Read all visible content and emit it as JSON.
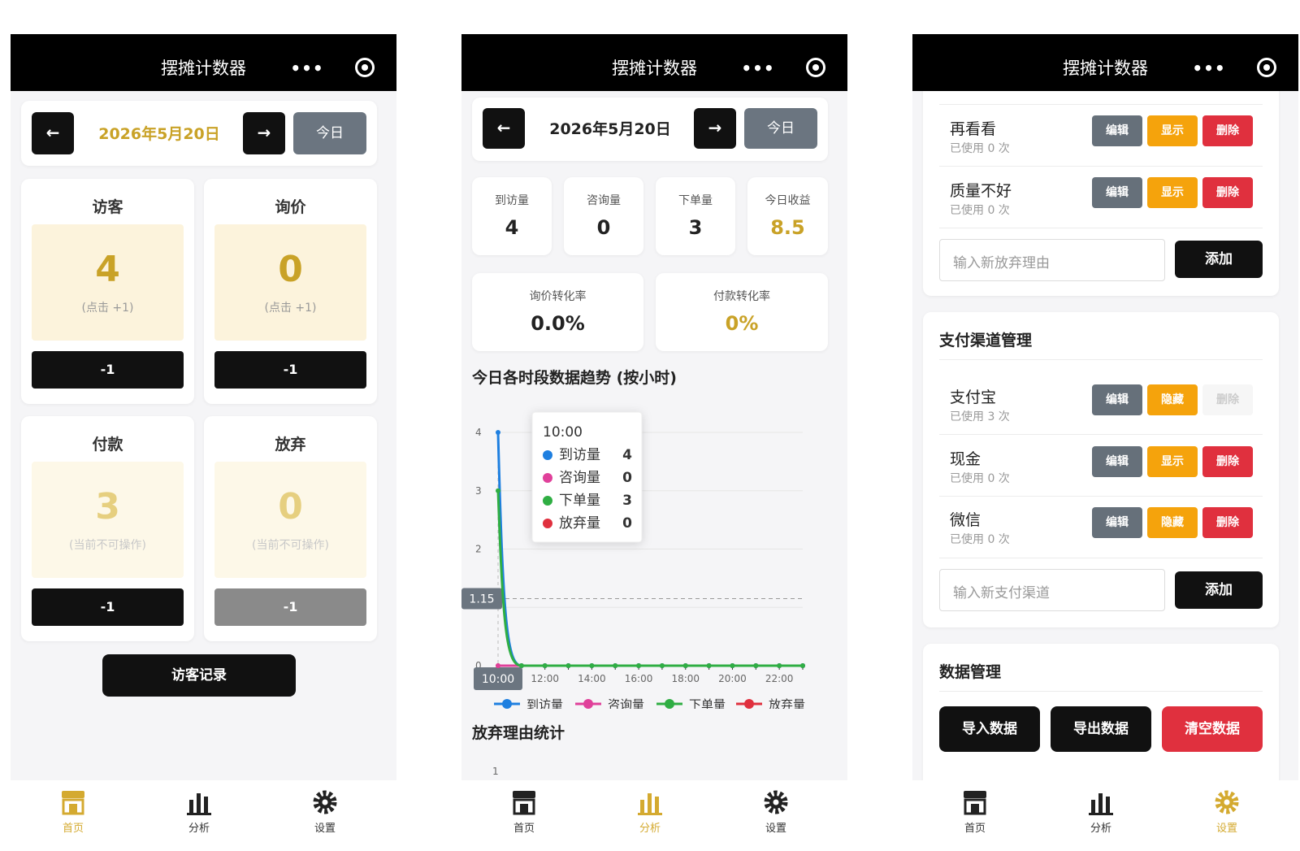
{
  "app": {
    "title": "摆摊计数器",
    "more_icon": "more-dots-icon",
    "close_icon": "record-target-icon"
  },
  "colors": {
    "gold": "#c9a227",
    "gold_bg": "#fcf3dc",
    "dark": "#111111",
    "gray_btn": "#6b7580",
    "orange": "#f5a30c",
    "red": "#e0303e",
    "visit": "#1e7fe0",
    "inquiry": "#e0409a",
    "order": "#2fae43",
    "abandon": "#e0303e"
  },
  "nav": {
    "home": "首页",
    "analysis": "分析",
    "settings": "设置"
  },
  "home": {
    "prev": "←",
    "next": "→",
    "date": "2026年5月20日",
    "today": "今日",
    "counters": [
      {
        "title": "访客",
        "value": "4",
        "hint": "(点击 +1)",
        "minus": "-1"
      },
      {
        "title": "询价",
        "value": "0",
        "hint": "(点击 +1)",
        "minus": "-1"
      },
      {
        "title": "付款",
        "value": "3",
        "hint": "(当前不可操作)",
        "minus": "-1"
      },
      {
        "title": "放弃",
        "value": "0",
        "hint": "(当前不可操作)",
        "minus": "-1"
      }
    ],
    "visitor_log": "访客记录"
  },
  "analysis": {
    "prev": "←",
    "next": "→",
    "date": "2026年5月20日",
    "today": "今日",
    "stats": [
      {
        "label": "到访量",
        "value": "4"
      },
      {
        "label": "咨询量",
        "value": "0"
      },
      {
        "label": "下单量",
        "value": "3"
      },
      {
        "label": "今日收益",
        "value": "8.5"
      }
    ],
    "rates": [
      {
        "label": "询价转化率",
        "value": "0.0%"
      },
      {
        "label": "付款转化率",
        "value": "0%"
      }
    ],
    "trend_title": "今日各时段数据趋势 (按小时)",
    "abandon_title": "放弃理由统计",
    "abandon_axis_tick": "1",
    "chart_data": {
      "type": "line",
      "x": [
        "10:00",
        "11:00",
        "12:00",
        "13:00",
        "14:00",
        "15:00",
        "16:00",
        "17:00",
        "18:00",
        "19:00",
        "20:00",
        "21:00",
        "22:00",
        "23:00"
      ],
      "x_tick_labels": [
        "10:00",
        "12:00",
        "14:00",
        "16:00",
        "18:00",
        "20:00",
        "22:00"
      ],
      "series": [
        {
          "name": "到访量",
          "values": [
            4,
            0,
            0,
            0,
            0,
            0,
            0,
            0,
            0,
            0,
            0,
            0,
            0,
            0
          ]
        },
        {
          "name": "咨询量",
          "values": [
            0,
            0,
            0,
            0,
            0,
            0,
            0,
            0,
            0,
            0,
            0,
            0,
            0,
            0
          ]
        },
        {
          "name": "下单量",
          "values": [
            3,
            0,
            0,
            0,
            0,
            0,
            0,
            0,
            0,
            0,
            0,
            0,
            0,
            0
          ]
        },
        {
          "name": "放弃量",
          "values": [
            0,
            0,
            0,
            0,
            0,
            0,
            0,
            0,
            0,
            0,
            0,
            0,
            0,
            0
          ]
        }
      ],
      "y_ticks": [
        0,
        1,
        2,
        3,
        4
      ],
      "ylim": [
        0,
        4
      ],
      "y_tick_labels": [
        "0",
        "2",
        "3",
        "4"
      ],
      "crosshair_y": 1.15,
      "crosshair_y_label": "1.15",
      "crosshair_x_label": "10:00",
      "tooltip": {
        "title": "10:00",
        "rows": [
          {
            "name": "到访量",
            "value": "4"
          },
          {
            "name": "咨询量",
            "value": "0"
          },
          {
            "name": "下单量",
            "value": "3"
          },
          {
            "name": "放弃量",
            "value": "0"
          }
        ]
      },
      "legend": "bottom",
      "grid": true
    }
  },
  "settings": {
    "reasons": [
      {
        "name": "再看看",
        "used": "已使用 0 次",
        "edit": "编辑",
        "toggle": "显示",
        "del": "删除"
      },
      {
        "name": "质量不好",
        "used": "已使用 0 次",
        "edit": "编辑",
        "toggle": "显示",
        "del": "删除"
      }
    ],
    "reason_placeholder": "输入新放弃理由",
    "add": "添加",
    "pay_title": "支付渠道管理",
    "channels": [
      {
        "name": "支付宝",
        "used": "已使用 3 次",
        "edit": "编辑",
        "toggle": "隐藏",
        "del": "删除"
      },
      {
        "name": "现金",
        "used": "已使用 0 次",
        "edit": "编辑",
        "toggle": "显示",
        "del": "删除"
      },
      {
        "name": "微信",
        "used": "已使用 0 次",
        "edit": "编辑",
        "toggle": "隐藏",
        "del": "删除"
      }
    ],
    "channel_placeholder": "输入新支付渠道",
    "data_title": "数据管理",
    "import": "导入数据",
    "export": "导出数据",
    "clear": "清空数据"
  }
}
